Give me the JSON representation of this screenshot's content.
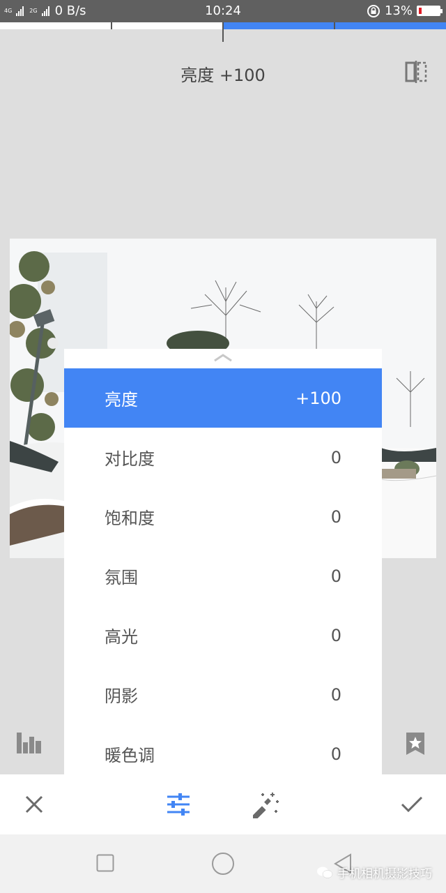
{
  "status_bar": {
    "network_top": "4G",
    "network_bottom": "2G",
    "data_speed": "0 B/s",
    "time": "10:24",
    "battery_percent": "13%",
    "battery_level": 0.13
  },
  "header": {
    "title": "亮度 +100",
    "compare_icon": "compare-split-icon"
  },
  "adjust_menu": {
    "items": [
      {
        "label": "亮度",
        "value": "+100",
        "selected": true
      },
      {
        "label": "对比度",
        "value": "0"
      },
      {
        "label": "饱和度",
        "value": "0"
      },
      {
        "label": "氛围",
        "value": "0"
      },
      {
        "label": "高光",
        "value": "0"
      },
      {
        "label": "阴影",
        "value": "0"
      },
      {
        "label": "暖色调",
        "value": "0"
      }
    ]
  },
  "toolbar": {
    "cancel_icon": "close-icon",
    "adjust_icon": "sliders-icon",
    "auto_icon": "magic-wand-icon",
    "apply_icon": "check-icon"
  },
  "watermark": {
    "text": "手机相机摄影技巧"
  },
  "colors": {
    "accent": "#4285f4",
    "background": "#dedede",
    "status_bar": "#606060"
  }
}
